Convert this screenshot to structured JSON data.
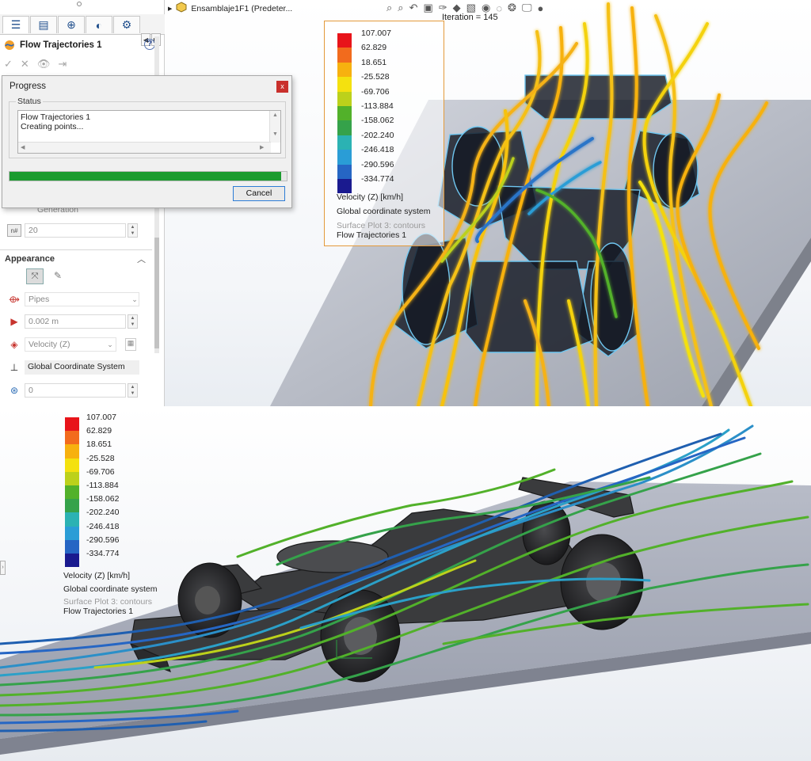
{
  "property_manager": {
    "title": "Flow Trajectories 1",
    "help": "?",
    "generation_label": "Generation",
    "points_value": "20",
    "appearance_header": "Appearance",
    "draw_as": "Pipes",
    "pipe_width": "0.002 m",
    "color_by": "Velocity (Z)",
    "coordinate_system": "Global Coordinate System",
    "offset_value": "0"
  },
  "progress_dialog": {
    "title": "Progress",
    "close": "x",
    "status_label": "Status",
    "status_lines": [
      "Flow Trajectories 1",
      "Creating points..."
    ],
    "progress": 0.98,
    "cancel_label": "Cancel"
  },
  "tree_root": {
    "label": "Ensamblaje1F1  (Predeter..."
  },
  "iteration": "Iteration = 145",
  "legend": {
    "values": [
      "107.007",
      "62.829",
      "18.651",
      "-25.528",
      "-69.706",
      "-113.884",
      "-158.062",
      "-202.240",
      "-246.418",
      "-290.596",
      "-334.774"
    ],
    "colors": [
      "#e8141a",
      "#f26b1d",
      "#f7b10f",
      "#f4e10f",
      "#bcd11b",
      "#52b12a",
      "#35a24a",
      "#2bb2b3",
      "#2a9dd6",
      "#2666c4",
      "#1a1a8f"
    ],
    "parameter": "Velocity (Z) [km/h]",
    "coord_system": "Global coordinate system",
    "plot_name": "Surface Plot 3: contours",
    "trajectory_name": "Flow Trajectories 1"
  },
  "colors": {
    "progress_green": "#1b9b2f",
    "legend_border": "#e39a3b",
    "car_body": "#3a3b3d",
    "ground_plane": "#a8acb8"
  }
}
